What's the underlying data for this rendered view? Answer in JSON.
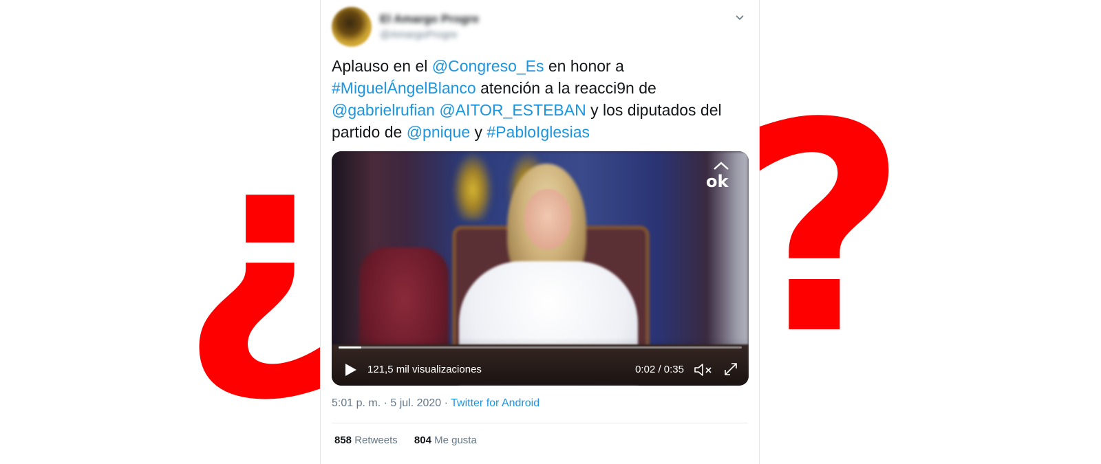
{
  "overlay": {
    "open_question_mark": "¿",
    "close_question_mark": "?",
    "color": "#ff0000"
  },
  "tweet": {
    "author_name": "El Amargo Progre",
    "author_handle": "@AmargoProgre",
    "menu_icon": "chevron-down-icon",
    "text": {
      "part1": "Aplauso en el ",
      "mention1": "@Congreso_Es",
      "part2": " en honor a ",
      "hashtag1": "#MiguelÁngelBlanco",
      "part3": " atención a la reacci9n de ",
      "mention2": "@gabrielrufian",
      "part4": " ",
      "mention3": "@AITOR_ESTEBAN",
      "part5": " y los diputados del partido de ",
      "mention4": "@pnique",
      "part6": " y ",
      "hashtag2": "#PabloIglesias"
    },
    "video": {
      "logo_text": "ok",
      "views": "121,5 mil visualizaciones",
      "time": "0:02 / 0:35",
      "progress": 0.057,
      "play_icon": "play-icon",
      "mute_icon": "mute-icon",
      "fullscreen_icon": "fullscreen-icon"
    },
    "meta": {
      "timestamp": "5:01 p. m. · 5 jul. 2020 · ",
      "source": "Twitter for Android"
    },
    "stats": {
      "retweets_count": "858",
      "retweets_label": "Retweets",
      "likes_count": "804",
      "likes_label": "Me gusta"
    },
    "link_color": "#1b95e0"
  }
}
